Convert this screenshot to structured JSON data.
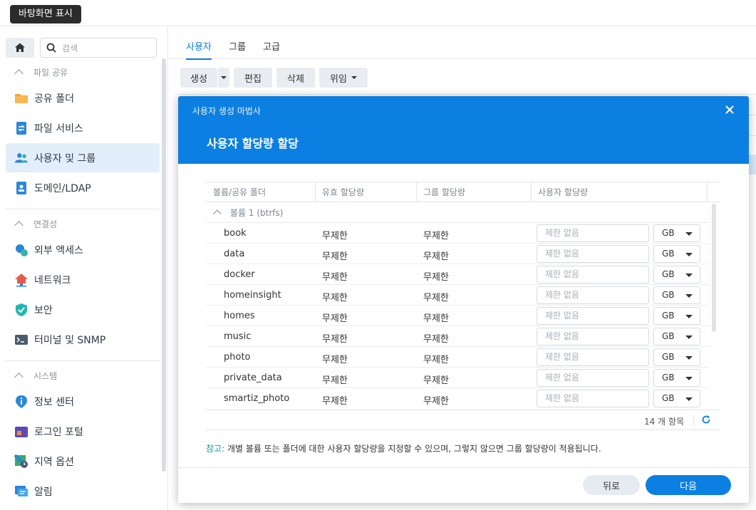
{
  "tooltip": "바탕화면 표시",
  "sidebar": {
    "search_placeholder": "검색",
    "sections": [
      {
        "label": "파일 공유"
      },
      {
        "label": "연결성"
      },
      {
        "label": "시스템"
      }
    ],
    "items": [
      {
        "label": "공유 폴더",
        "icon": "folder-icon"
      },
      {
        "label": "파일 서비스",
        "icon": "file-services-icon"
      },
      {
        "label": "사용자 및 그룹",
        "icon": "users-icon",
        "active": true
      },
      {
        "label": "도메인/LDAP",
        "icon": "domain-icon"
      },
      {
        "label": "외부 액세스",
        "icon": "external-access-icon"
      },
      {
        "label": "네트워크",
        "icon": "network-icon"
      },
      {
        "label": "보안",
        "icon": "shield-icon"
      },
      {
        "label": "터미널 및 SNMP",
        "icon": "terminal-icon"
      },
      {
        "label": "정보 센터",
        "icon": "info-icon"
      },
      {
        "label": "로그인 포털",
        "icon": "login-portal-icon"
      },
      {
        "label": "지역 옵션",
        "icon": "region-icon"
      },
      {
        "label": "알림",
        "icon": "notification-icon"
      }
    ]
  },
  "tabs": [
    {
      "label": "사용자",
      "active": true
    },
    {
      "label": "그룹"
    },
    {
      "label": "고급"
    }
  ],
  "toolbar": {
    "create": "생성",
    "edit": "편집",
    "delete": "삭제",
    "delegate": "위임"
  },
  "modal": {
    "caption": "사용자 생성 마법사",
    "title": "사용자 할당량 할당",
    "columns": [
      "볼륨/공유 폴더",
      "유효 할당량",
      "그룹 할당량",
      "사용자 할당량"
    ],
    "group_label": "볼륨 1 (btrfs)",
    "rows": [
      {
        "name": "book",
        "effective": "무제한",
        "group": "무제한",
        "placeholder": "제한 없음",
        "unit": "GB"
      },
      {
        "name": "data",
        "effective": "무제한",
        "group": "무제한",
        "placeholder": "제한 없음",
        "unit": "GB"
      },
      {
        "name": "docker",
        "effective": "무제한",
        "group": "무제한",
        "placeholder": "제한 없음",
        "unit": "GB"
      },
      {
        "name": "homeinsight",
        "effective": "무제한",
        "group": "무제한",
        "placeholder": "제한 없음",
        "unit": "GB"
      },
      {
        "name": "homes",
        "effective": "무제한",
        "group": "무제한",
        "placeholder": "제한 없음",
        "unit": "GB"
      },
      {
        "name": "music",
        "effective": "무제한",
        "group": "무제한",
        "placeholder": "제한 없음",
        "unit": "GB"
      },
      {
        "name": "photo",
        "effective": "무제한",
        "group": "무제한",
        "placeholder": "제한 없음",
        "unit": "GB"
      },
      {
        "name": "private_data",
        "effective": "무제한",
        "group": "무제한",
        "placeholder": "제한 없음",
        "unit": "GB"
      },
      {
        "name": "smartiz_photo",
        "effective": "무제한",
        "group": "무제한",
        "placeholder": "제한 없음",
        "unit": "GB"
      }
    ],
    "item_count": "14 개 항목",
    "note_key": "참고:",
    "note_text": " 개별 볼륨 또는 폴더에 대한 사용자 할당량을 지정할 수 있으며, 그렇지 않으면 그룹 할당량이 적용됩니다.",
    "back": "뒤로",
    "next": "다음"
  },
  "colors": {
    "accent": "#0c7fe2",
    "note_key": "#0b9e9e"
  }
}
